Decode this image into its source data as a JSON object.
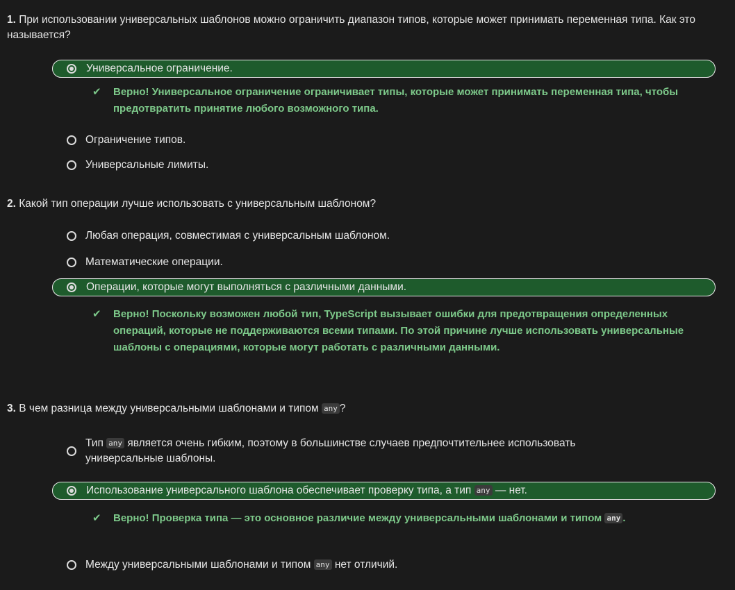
{
  "q1": {
    "num": "1.",
    "text": "При использовании универсальных шаблонов можно ограничить диапазон типов, которые может принимать переменная типа. Как это называется?",
    "options": [
      "Универсальное ограничение.",
      "Ограничение типов.",
      "Универсальные лимиты."
    ],
    "selected": 0,
    "feedback": "Верно! Универсальное ограничение ограничивает типы, которые может принимать переменная типа, чтобы предотвратить принятие любого возможного типа."
  },
  "q2": {
    "num": "2.",
    "text": "Какой тип операции лучше использовать с универсальным шаблоном?",
    "options": [
      "Любая операция, совместимая с универсальным шаблоном.",
      "Математические операции.",
      "Операции, которые могут выполняться с различными данными."
    ],
    "selected": 2,
    "feedback": "Верно! Поскольку возможен любой тип, TypeScript вызывает ошибки для предотвращения определенных операций, которые не поддерживаются всеми типами. По этой причине лучше использовать универсальные шаблоны с операциями, которые могут работать с различными данными."
  },
  "q3": {
    "num": "3.",
    "text_before": "В чем разница между универсальными шаблонами и типом ",
    "code": "any",
    "text_after": "?",
    "opt1_before": "Тип ",
    "opt1_after": " является очень гибким, поэтому в большинстве случаев предпочтительнее использовать универсальные шаблоны.",
    "opt2_before": "Использование универсального шаблона обеспечивает проверку типа, а тип ",
    "opt2_after": " — нет.",
    "feedback_before": "Верно! Проверка типа — это основное различие между универсальными шаблонами и типом ",
    "feedback_after": ".",
    "opt3_before": "Между универсальными шаблонами и типом ",
    "opt3_after": " нет отличий.",
    "selected": 1
  },
  "icons": {
    "check": "checkmark-icon",
    "radio": "radio-button-icon"
  },
  "colors": {
    "background": "#1b1b1b",
    "selected_bg": "#1e5b2c",
    "feedback": "#7dc98a"
  }
}
